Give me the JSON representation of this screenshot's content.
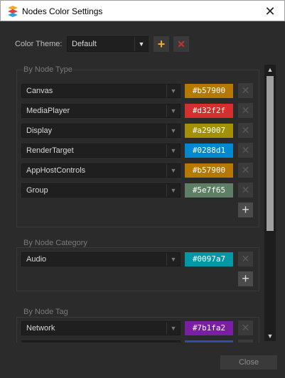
{
  "window": {
    "title": "Nodes Color Settings",
    "close_glyph": "✕"
  },
  "theme": {
    "label": "Color Theme:",
    "value": "Default",
    "add_glyph": "+",
    "delete_glyph": "✕"
  },
  "groups": [
    {
      "title": "By Node Type",
      "rows": [
        {
          "name": "Canvas",
          "color": "#b57900"
        },
        {
          "name": "MediaPlayer",
          "color": "#d32f2f"
        },
        {
          "name": "Display",
          "color": "#a29007"
        },
        {
          "name": "RenderTarget",
          "color": "#0288d1"
        },
        {
          "name": "AppHostControls",
          "color": "#b57900"
        },
        {
          "name": "Group",
          "color": "#5e7f65"
        }
      ]
    },
    {
      "title": "By Node Category",
      "rows": [
        {
          "name": "Audio",
          "color": "#0097a7"
        }
      ]
    },
    {
      "title": "By Node Tag",
      "rows": [
        {
          "name": "Network",
          "color": "#7b1fa2"
        }
      ]
    }
  ],
  "footer": {
    "close_label": "Close"
  },
  "icons": {
    "dropdown": "chevron-down-icon",
    "remove": "close-icon",
    "add": "plus-icon"
  }
}
